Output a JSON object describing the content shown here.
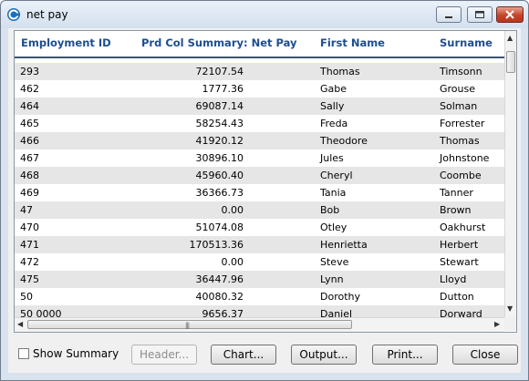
{
  "window": {
    "title": "net pay"
  },
  "table": {
    "columns": [
      "Employment ID",
      "Prd Col Summary: Net Pay",
      "First Name",
      "Surname"
    ],
    "rows": [
      {
        "id": "293",
        "net": "72107.54",
        "first": "Thomas",
        "last": "Timsonn"
      },
      {
        "id": "462",
        "net": "1777.36",
        "first": "Gabe",
        "last": "Grouse"
      },
      {
        "id": "464",
        "net": "69087.14",
        "first": "Sally",
        "last": "Solman"
      },
      {
        "id": "465",
        "net": "58254.43",
        "first": "Freda",
        "last": "Forrester"
      },
      {
        "id": "466",
        "net": "41920.12",
        "first": "Theodore",
        "last": "Thomas"
      },
      {
        "id": "467",
        "net": "30896.10",
        "first": "Jules",
        "last": "Johnstone"
      },
      {
        "id": "468",
        "net": "45960.40",
        "first": "Cheryl",
        "last": "Coombe"
      },
      {
        "id": "469",
        "net": "36366.73",
        "first": "Tania",
        "last": "Tanner"
      },
      {
        "id": "47",
        "net": "0.00",
        "first": "Bob",
        "last": "Brown"
      },
      {
        "id": "470",
        "net": "51074.08",
        "first": "Otley",
        "last": "Oakhurst"
      },
      {
        "id": "471",
        "net": "170513.36",
        "first": "Henrietta",
        "last": "Herbert"
      },
      {
        "id": "472",
        "net": "0.00",
        "first": "Steve",
        "last": "Stewart"
      },
      {
        "id": "475",
        "net": "36447.96",
        "first": "Lynn",
        "last": "Lloyd"
      },
      {
        "id": "50",
        "net": "40080.32",
        "first": "Dorothy",
        "last": "Dutton"
      },
      {
        "id": "50 0000",
        "net": "9656.37",
        "first": "Daniel",
        "last": "Dorward"
      }
    ]
  },
  "footer": {
    "show_summary_label": "Show Summary",
    "header_label": "Header...",
    "chart_label": "Chart...",
    "output_label": "Output...",
    "print_label": "Print...",
    "close_label": "Close"
  },
  "colors": {
    "header_text": "#1d4e8f",
    "alt_row": "#e6e6e6",
    "header_rule": "#3b5478"
  }
}
